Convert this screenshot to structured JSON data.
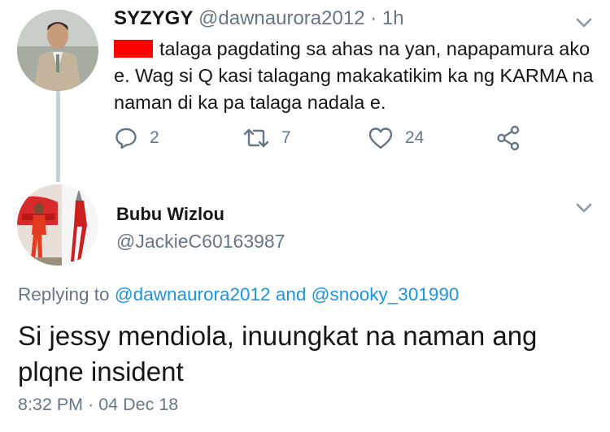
{
  "reply_to_tweet": {
    "display_name": "SYZYGY",
    "handle": "@dawnaurora2012",
    "separator": "·",
    "time_ago": "1h",
    "text": "talaga pagdating sa ahas na yan, napapamura ako e. Wag si Q kasi talagang makakatikim ka ng KARMA na naman di ka pa talaga nadala e.",
    "actions": {
      "reply_count": "2",
      "retweet_count": "7",
      "like_count": "24"
    },
    "icons": [
      "reply-icon",
      "retweet-icon",
      "like-icon",
      "share-icon",
      "chevron-down-icon"
    ]
  },
  "main_tweet": {
    "display_name": "Bubu Wizlou",
    "handle": "@JackieC60163987",
    "replying_prefix": "Replying to",
    "replying_user_1": "@dawnaurora2012",
    "replying_and": "and",
    "replying_user_2": "@snooky_301990",
    "text": "Si jessy mendiola, inuungkat na naman ang plqne insident",
    "time": "8:32 PM",
    "separator": "·",
    "date": "04 Dec 18"
  },
  "colors": {
    "link": "#1b95e0",
    "muted": "#657786",
    "redaction": "#ff0000",
    "thread_line": "#c4cfd6"
  }
}
